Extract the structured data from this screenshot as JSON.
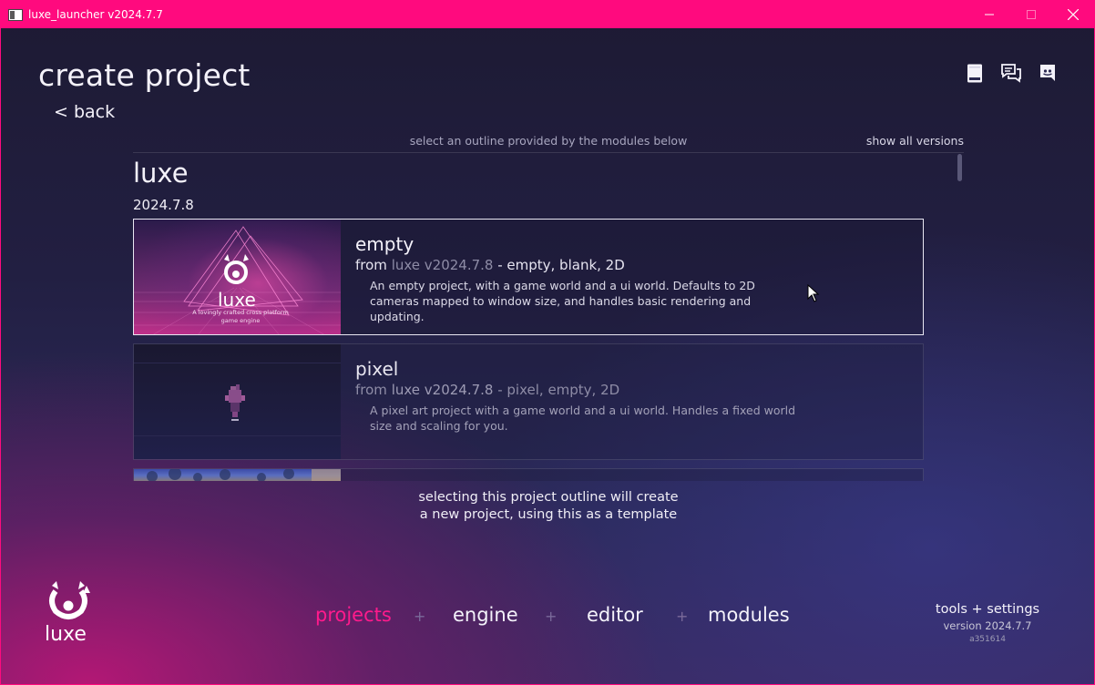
{
  "window": {
    "title": "luxe_launcher v2024.7.7",
    "controls": {
      "minimize": "—",
      "maximize": "☐",
      "close": "✕"
    },
    "accent": "#ff0a7e"
  },
  "header": {
    "title": "create project",
    "back": "< back",
    "icons": [
      "book-icon",
      "chat-icon",
      "discord-icon"
    ]
  },
  "outlines": {
    "hint": "select an outline provided by the modules below",
    "show_all": "show all versions",
    "module": "luxe",
    "version": "2024.7.8",
    "cards": [
      {
        "title": "empty",
        "from_prefix": "from ",
        "from_version": "luxe v2024.7.8",
        "tags": " - empty, blank, 2D",
        "description": "An empty project, with a game world and a ui world. Defaults to 2D cameras mapped to window size, and handles basic rendering and updating.",
        "thumb_text": "luxe",
        "thumb_tagline": "A lovingly crafted cross platform game engine",
        "selected": true
      },
      {
        "title": "pixel",
        "from_prefix": "from ",
        "from_version": "luxe v2024.7.8",
        "tags": " - pixel, empty, 2D",
        "description": "A pixel art project with a game world and a ui world. Handles a fixed world size and scaling for you.",
        "selected": false
      }
    ]
  },
  "select_note": {
    "line1": "selecting this project outline will create",
    "line2": "a new project, using this as a template"
  },
  "footer": {
    "logo_text": "luxe",
    "nav": [
      {
        "label": "projects",
        "active": true
      },
      {
        "label": "engine",
        "active": false
      },
      {
        "label": "editor",
        "active": false
      },
      {
        "label": "modules",
        "active": false
      }
    ],
    "nav_separator": "+",
    "tools_label": "tools + settings",
    "version": "version 2024.7.7",
    "hash": "a351614",
    "active_color": "#ff1a8c"
  }
}
